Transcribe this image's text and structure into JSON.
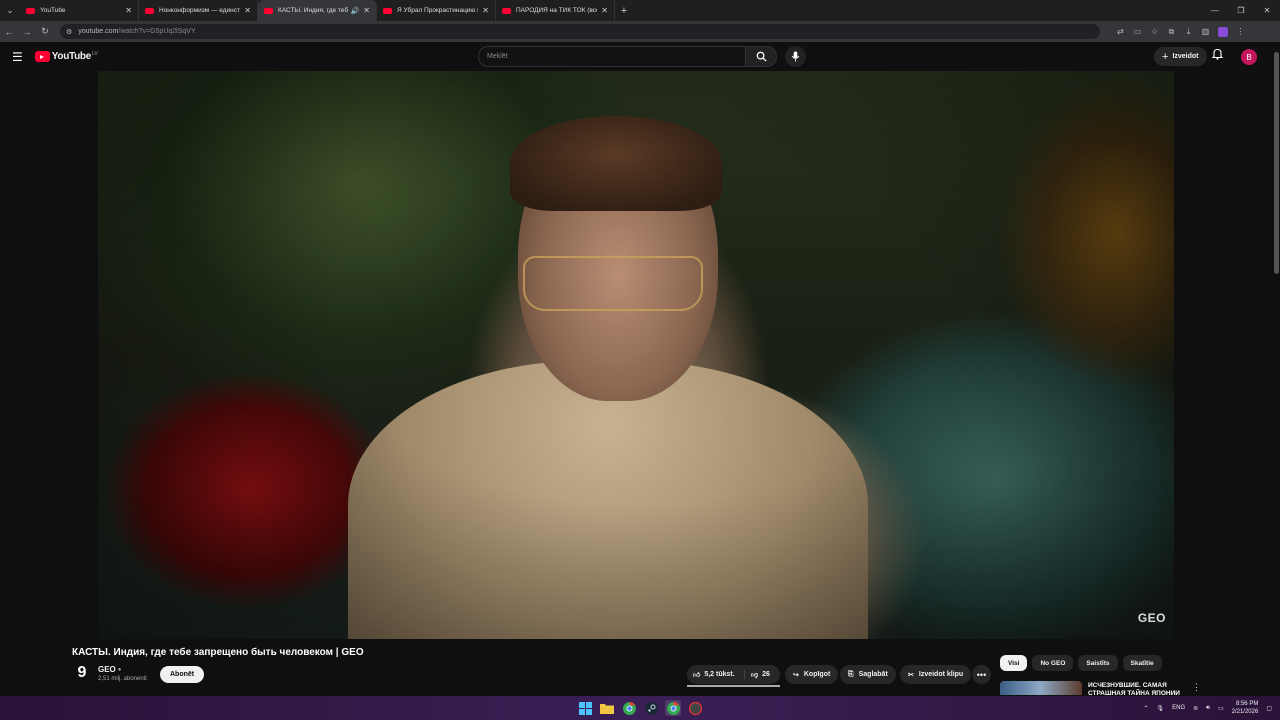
{
  "browser": {
    "tabs": [
      {
        "title": "YouTube",
        "active": false
      },
      {
        "title": "Нонконформизм — единствен",
        "active": false
      },
      {
        "title": "КАСТЫ. Индия, где тебе за",
        "active": true
      },
      {
        "title": "Я Убрал Прокрастинацию Нa",
        "active": false
      },
      {
        "title": "ПАРОДИЯ на ТИК ТОК (все ти",
        "active": false
      }
    ],
    "new_tab": "+",
    "url_main": "youtube.com",
    "url_rest": "/watch?v=G5pUq2lSqVY"
  },
  "youtube": {
    "logo_text": "YouTube",
    "country_code": "LV",
    "search_placeholder": "Meklēt",
    "create_label": "Izveidot",
    "avatar_letter": "B"
  },
  "video": {
    "watermark": "GEO",
    "title": "КАСТЫ. Индия, где тебе запрещено быть человеком | GEO",
    "channel": {
      "logo": "9",
      "name": "GEO",
      "subscribers": "2,51 milj. abonenti",
      "subscribe_label": "Abonēt"
    },
    "actions": {
      "likes": "5,2 tūkst.",
      "dislikes": "26",
      "share": "Kopīgot",
      "save": "Saglabāt",
      "clip": "Izveidot klipu",
      "more": "•••"
    }
  },
  "sidebar": {
    "chips": [
      {
        "label": "Visi",
        "active": true
      },
      {
        "label": "No GEO",
        "active": false
      },
      {
        "label": "Saistīts",
        "active": false
      },
      {
        "label": "Skatītie",
        "active": false
      }
    ],
    "recommendation": {
      "title": "ИСЧЕЗНУВШИЕ. САМАЯ СТРАШНАЯ ТАЙНА ЯПОНИИ"
    }
  },
  "taskbar": {
    "language": "ENG",
    "time": "8:56 PM",
    "date": "2/21/2026"
  },
  "colors": {
    "brand_red": "#ff0033",
    "taskbar": "#3a1f56",
    "page_bg": "#0f0f0f"
  }
}
